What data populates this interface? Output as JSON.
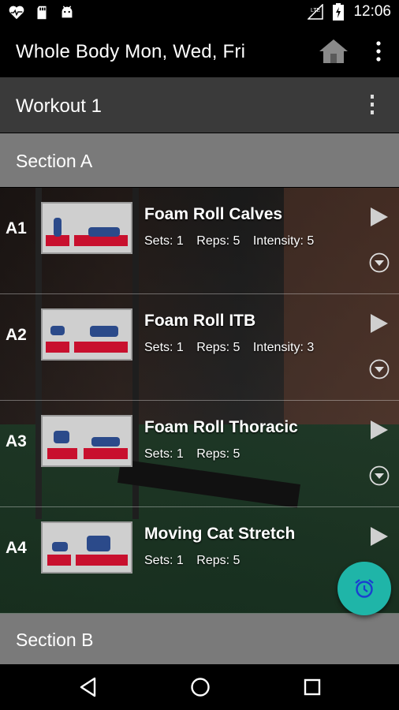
{
  "status_bar": {
    "time": "12:06",
    "icons": [
      "heart-monitor-icon",
      "sd-card-icon",
      "android-icon",
      "signal-icon",
      "battery-icon"
    ]
  },
  "app_bar": {
    "title": "Whole Body Mon, Wed, Fri",
    "icons": [
      "home-icon",
      "overflow-menu-icon"
    ]
  },
  "workout": {
    "title": "Workout 1"
  },
  "sections": [
    {
      "title": "Section A",
      "exercises": [
        {
          "code": "A1",
          "name": "Foam Roll Calves",
          "sets": "Sets: 1",
          "reps": "Reps: 5",
          "intensity": "Intensity: 5"
        },
        {
          "code": "A2",
          "name": "Foam Roll ITB",
          "sets": "Sets: 1",
          "reps": "Reps: 5",
          "intensity": "Intensity: 3"
        },
        {
          "code": "A3",
          "name": "Foam Roll Thoracic",
          "sets": "Sets: 1",
          "reps": "Reps: 5",
          "intensity": ""
        },
        {
          "code": "A4",
          "name": "Moving Cat Stretch",
          "sets": "Sets: 1",
          "reps": "Reps: 5",
          "intensity": ""
        }
      ]
    },
    {
      "title": "Section B",
      "exercises": []
    }
  ],
  "fab": {
    "icon": "alarm-clock-icon",
    "color": "#1fb5a8"
  },
  "nav_bar": {
    "icons": [
      "back-icon",
      "home-circle-icon",
      "recents-icon"
    ]
  },
  "colors": {
    "workout_bar": "#3a3a3a",
    "section_bar": "#7a7a7a",
    "accent": "#1fb5a8"
  }
}
